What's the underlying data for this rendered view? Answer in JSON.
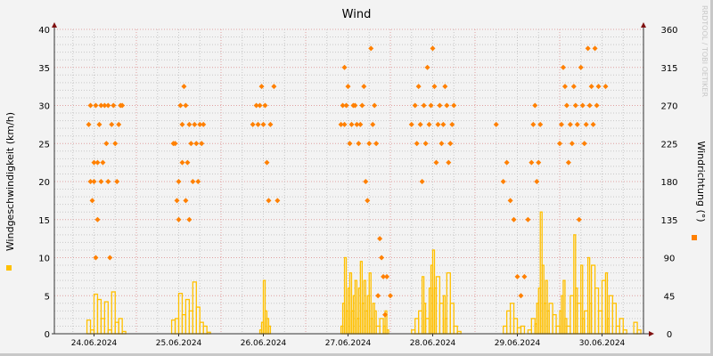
{
  "chart_data": {
    "type": "line",
    "title": "Wind",
    "ylabel": "Windgeschwindigkeit (km/h)",
    "y2label": "Windrichtung (°)",
    "watermark": "RRDTOOL / TOBI OETIKER",
    "ylim": [
      0,
      40
    ],
    "y2lim": [
      0,
      360
    ],
    "yticks": [
      0,
      5,
      10,
      15,
      20,
      25,
      30,
      35,
      40
    ],
    "y2ticks": [
      0,
      45,
      90,
      135,
      180,
      225,
      270,
      315,
      360
    ],
    "xtick_labels": [
      "24.06.2024",
      "25.06.2024",
      "26.06.2024",
      "27.06.2024",
      "28.06.2024",
      "29.06.2024",
      "30.06.2024"
    ],
    "x_unit": "hours since 24.06.2024 00:00",
    "grid": true,
    "colors": {
      "speed": "#ffc000",
      "direction": "#ff8000",
      "axis_arrow": "#801010",
      "major_grid": "#e0a0a0",
      "minor_grid": "#c8c8c8"
    },
    "series": [
      {
        "name": "Windgeschwindigkeit",
        "type": "step",
        "axis": "left",
        "points": [
          [
            10,
            1.8
          ],
          [
            11,
            0.5
          ],
          [
            12,
            5.2
          ],
          [
            13,
            4.5
          ],
          [
            14,
            2
          ],
          [
            15,
            4.2
          ],
          [
            16,
            0.5
          ],
          [
            17,
            5.5
          ],
          [
            18,
            1.5
          ],
          [
            19,
            2
          ],
          [
            20,
            0.3
          ],
          [
            21,
            0
          ],
          [
            34,
            1.8
          ],
          [
            35,
            2
          ],
          [
            36,
            5.3
          ],
          [
            37,
            2.5
          ],
          [
            38,
            4.5
          ],
          [
            39,
            3
          ],
          [
            40,
            6.8
          ],
          [
            41,
            3.5
          ],
          [
            42,
            1.5
          ],
          [
            43,
            1
          ],
          [
            44,
            0.2
          ],
          [
            45,
            0
          ],
          [
            59,
            0.5
          ],
          [
            59.5,
            1.5
          ],
          [
            60,
            7
          ],
          [
            60.5,
            3
          ],
          [
            61,
            2
          ],
          [
            61.5,
            1
          ],
          [
            62,
            0
          ],
          [
            82,
            1
          ],
          [
            82.5,
            4
          ],
          [
            83,
            10
          ],
          [
            83.5,
            3
          ],
          [
            84,
            6
          ],
          [
            84.5,
            8
          ],
          [
            85,
            3
          ],
          [
            85.5,
            5
          ],
          [
            86,
            7
          ],
          [
            86.5,
            2
          ],
          [
            87,
            6
          ],
          [
            87.5,
            9.5
          ],
          [
            88,
            4
          ],
          [
            88.5,
            7
          ],
          [
            89,
            3
          ],
          [
            89.5,
            5
          ],
          [
            90,
            8
          ],
          [
            90.5,
            2
          ],
          [
            91,
            4
          ],
          [
            91.5,
            3
          ],
          [
            92,
            1
          ],
          [
            93,
            2
          ],
          [
            94,
            1
          ],
          [
            94.5,
            3
          ],
          [
            95,
            0.5
          ],
          [
            95.5,
            0
          ],
          [
            102,
            0.5
          ],
          [
            103,
            2
          ],
          [
            104,
            3
          ],
          [
            105,
            7.5
          ],
          [
            105.5,
            4
          ],
          [
            106,
            2
          ],
          [
            107,
            6
          ],
          [
            107.5,
            9
          ],
          [
            108,
            11
          ],
          [
            108.5,
            6
          ],
          [
            109,
            7.5
          ],
          [
            110,
            4
          ],
          [
            111,
            5
          ],
          [
            111.5,
            2
          ],
          [
            112,
            8
          ],
          [
            113,
            4
          ],
          [
            114,
            1
          ],
          [
            115,
            0.3
          ],
          [
            116,
            0
          ],
          [
            128,
            1
          ],
          [
            129,
            3
          ],
          [
            130,
            4
          ],
          [
            131,
            2
          ],
          [
            132,
            0.8
          ],
          [
            133,
            1
          ],
          [
            134,
            0
          ],
          [
            135,
            0.5
          ],
          [
            136,
            2
          ],
          [
            137,
            1.3
          ],
          [
            137.5,
            4
          ],
          [
            138,
            6
          ],
          [
            138.5,
            16
          ],
          [
            139,
            9
          ],
          [
            139.5,
            4
          ],
          [
            140,
            7
          ],
          [
            140.5,
            3
          ],
          [
            141,
            4
          ],
          [
            142,
            2.5
          ],
          [
            143,
            1
          ],
          [
            144,
            3
          ],
          [
            144.5,
            5
          ],
          [
            145,
            7
          ],
          [
            145.5,
            2
          ],
          [
            146,
            1
          ],
          [
            147,
            5
          ],
          [
            148,
            13
          ],
          [
            148.5,
            6
          ],
          [
            149,
            4
          ],
          [
            150,
            9
          ],
          [
            150.5,
            2
          ],
          [
            151,
            3
          ],
          [
            152,
            10
          ],
          [
            152.5,
            4
          ],
          [
            153,
            9
          ],
          [
            154,
            6
          ],
          [
            155,
            3
          ],
          [
            156,
            7
          ],
          [
            157,
            8
          ],
          [
            157.5,
            2
          ],
          [
            158,
            5
          ],
          [
            159,
            4
          ],
          [
            160,
            1
          ],
          [
            161,
            2
          ],
          [
            162,
            0.5
          ],
          [
            163,
            0
          ],
          [
            165,
            1.5
          ],
          [
            166,
            0.5
          ],
          [
            167,
            0
          ]
        ]
      },
      {
        "name": "Windrichtung",
        "type": "points",
        "axis": "right",
        "points": [
          [
            10.5,
            247.5
          ],
          [
            11,
            270
          ],
          [
            11,
            180
          ],
          [
            11.5,
            157.5
          ],
          [
            12,
            180
          ],
          [
            12,
            202.5
          ],
          [
            12.5,
            270
          ],
          [
            12.5,
            90
          ],
          [
            13,
            202.5
          ],
          [
            13,
            135
          ],
          [
            13.5,
            247.5
          ],
          [
            14,
            270
          ],
          [
            14,
            180
          ],
          [
            14.5,
            202.5
          ],
          [
            15,
            270
          ],
          [
            15.5,
            225
          ],
          [
            16,
            270
          ],
          [
            16,
            180
          ],
          [
            16.5,
            90
          ],
          [
            17,
            247.5
          ],
          [
            17.5,
            270
          ],
          [
            18,
            225
          ],
          [
            18.5,
            180
          ],
          [
            19,
            247.5
          ],
          [
            19.5,
            270
          ],
          [
            20,
            270
          ],
          [
            34.5,
            225
          ],
          [
            35,
            225
          ],
          [
            35.5,
            157.5
          ],
          [
            36,
            180
          ],
          [
            36,
            135
          ],
          [
            36.5,
            270
          ],
          [
            37,
            247.5
          ],
          [
            37,
            202.5
          ],
          [
            37.5,
            292.5
          ],
          [
            38,
            157.5
          ],
          [
            38,
            270
          ],
          [
            38.5,
            202.5
          ],
          [
            39,
            247.5
          ],
          [
            39,
            135
          ],
          [
            39.5,
            225
          ],
          [
            40,
            180
          ],
          [
            40.5,
            247.5
          ],
          [
            41,
            225
          ],
          [
            41.5,
            180
          ],
          [
            42,
            247.5
          ],
          [
            42.5,
            225
          ],
          [
            43,
            247.5
          ],
          [
            57,
            247.5
          ],
          [
            58,
            270
          ],
          [
            58.5,
            247.5
          ],
          [
            59,
            270
          ],
          [
            59.5,
            292.5
          ],
          [
            60,
            247.5
          ],
          [
            60.5,
            270
          ],
          [
            61,
            202.5
          ],
          [
            61.5,
            157.5
          ],
          [
            62,
            247.5
          ],
          [
            63,
            292.5
          ],
          [
            64,
            157.5
          ],
          [
            82,
            247.5
          ],
          [
            82.5,
            270
          ],
          [
            83,
            315
          ],
          [
            83,
            247.5
          ],
          [
            83.5,
            270
          ],
          [
            84,
            292.5
          ],
          [
            84.5,
            225
          ],
          [
            85,
            247.5
          ],
          [
            85.5,
            270
          ],
          [
            86,
            270
          ],
          [
            86.5,
            247.5
          ],
          [
            87,
            225
          ],
          [
            87.5,
            247.5
          ],
          [
            88,
            270
          ],
          [
            88.5,
            292.5
          ],
          [
            89,
            180
          ],
          [
            89.5,
            157.5
          ],
          [
            90,
            225
          ],
          [
            90.5,
            337.5
          ],
          [
            91,
            247.5
          ],
          [
            91.5,
            270
          ],
          [
            92,
            225
          ],
          [
            92.5,
            45
          ],
          [
            93,
            112.5
          ],
          [
            93.5,
            90
          ],
          [
            94,
            67.5
          ],
          [
            94.5,
            22.5
          ],
          [
            95,
            67.5
          ],
          [
            96,
            45
          ],
          [
            102,
            247.5
          ],
          [
            103,
            270
          ],
          [
            103.5,
            225
          ],
          [
            104,
            292.5
          ],
          [
            104.5,
            247.5
          ],
          [
            105,
            180
          ],
          [
            105.5,
            270
          ],
          [
            106,
            225
          ],
          [
            106.5,
            315
          ],
          [
            107,
            247.5
          ],
          [
            107.5,
            270
          ],
          [
            108,
            337.5
          ],
          [
            108.5,
            292.5
          ],
          [
            109,
            202.5
          ],
          [
            109.5,
            247.5
          ],
          [
            110,
            270
          ],
          [
            110.5,
            225
          ],
          [
            111,
            247.5
          ],
          [
            111.5,
            292.5
          ],
          [
            112,
            270
          ],
          [
            112.5,
            202.5
          ],
          [
            113,
            225
          ],
          [
            113.5,
            247.5
          ],
          [
            114,
            270
          ],
          [
            126,
            247.5
          ],
          [
            128,
            180
          ],
          [
            129,
            202.5
          ],
          [
            130,
            157.5
          ],
          [
            131,
            135
          ],
          [
            132,
            67.5
          ],
          [
            133,
            45
          ],
          [
            134,
            67.5
          ],
          [
            135,
            135
          ],
          [
            136,
            202.5
          ],
          [
            136.5,
            247.5
          ],
          [
            137,
            270
          ],
          [
            137.5,
            180
          ],
          [
            138,
            202.5
          ],
          [
            138.5,
            247.5
          ],
          [
            144,
            225
          ],
          [
            144.5,
            247.5
          ],
          [
            145,
            315
          ],
          [
            145.5,
            292.5
          ],
          [
            146,
            270
          ],
          [
            146.5,
            202.5
          ],
          [
            147,
            247.5
          ],
          [
            147.5,
            225
          ],
          [
            148,
            292.5
          ],
          [
            148.5,
            270
          ],
          [
            149,
            247.5
          ],
          [
            149.5,
            135
          ],
          [
            150,
            315
          ],
          [
            150.5,
            270
          ],
          [
            151,
            225
          ],
          [
            151.5,
            247.5
          ],
          [
            152,
            337.5
          ],
          [
            152.5,
            270
          ],
          [
            153,
            292.5
          ],
          [
            153.5,
            247.5
          ],
          [
            154,
            337.5
          ],
          [
            154.5,
            270
          ],
          [
            155,
            292.5
          ],
          [
            157,
            292.5
          ]
        ]
      }
    ],
    "legend": [
      {
        "label": "Windgeschwindigkeit",
        "color": "#ffc000",
        "position": "left"
      },
      {
        "label": "Windrichtung",
        "color": "#ff8000",
        "position": "right"
      }
    ]
  }
}
